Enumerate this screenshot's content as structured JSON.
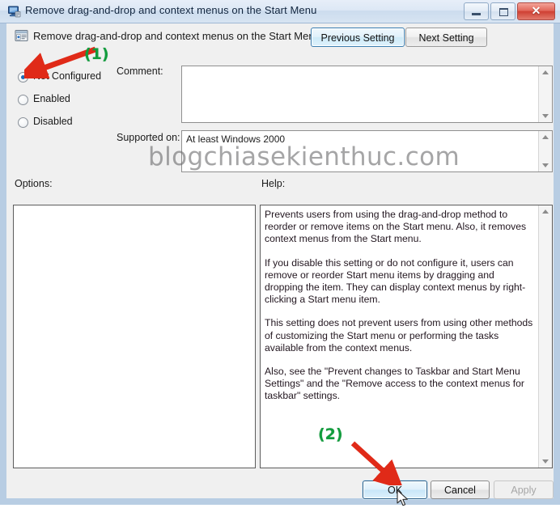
{
  "window": {
    "title": "Remove drag-and-drop and context menus on the Start Menu",
    "title_icon": "computer-policy-icon",
    "minimize_label": "–",
    "maximize_label": "",
    "close_label": "✕"
  },
  "header": {
    "policy_icon": "policy-setting-icon",
    "policy_name": "Remove drag-and-drop and context menus on the Start Menu",
    "previous_setting_label": "Previous Setting",
    "next_setting_label": "Next Setting"
  },
  "state_options": {
    "selected": "Not Configured",
    "items": [
      {
        "label": "Not Configured",
        "checked": true
      },
      {
        "label": "Enabled",
        "checked": false
      },
      {
        "label": "Disabled",
        "checked": false
      }
    ]
  },
  "comment": {
    "label": "Comment:",
    "value": "",
    "placeholder": ""
  },
  "supported_on": {
    "label": "Supported on:",
    "value": "At least Windows 2000"
  },
  "options_panel": {
    "label": "Options:",
    "content": ""
  },
  "help_panel": {
    "label": "Help:",
    "paragraphs": [
      "Prevents users from using the drag-and-drop method to reorder or remove items on the Start menu. Also, it removes context menus from the Start menu.",
      "If you disable this setting or do not configure it, users can remove or reorder Start menu items by dragging and dropping the item. They can display context menus by right-clicking a Start menu item.",
      "This setting does not prevent users from using other methods of customizing the Start menu or performing the tasks available from the context menus.",
      "Also, see the \"Prevent changes to Taskbar and Start Menu Settings\" and the \"Remove access to the context menus for taskbar\" settings."
    ]
  },
  "footer": {
    "ok_label": "OK",
    "cancel_label": "Cancel",
    "apply_label": "Apply",
    "apply_disabled": true
  },
  "watermark": {
    "text": "blogchiasekienthuc.com"
  },
  "annotations": [
    {
      "id": "step-1",
      "label": "(1)",
      "target": "not-configured-radio"
    },
    {
      "id": "step-2",
      "label": "(2)",
      "target": "ok-button"
    }
  ],
  "colors": {
    "accent_blue": "#3c7fb1",
    "close_red": "#cf4033",
    "annotation_green": "#109c3c",
    "annotation_red": "#e02a18",
    "radio_dot": "#1c6cb5"
  }
}
